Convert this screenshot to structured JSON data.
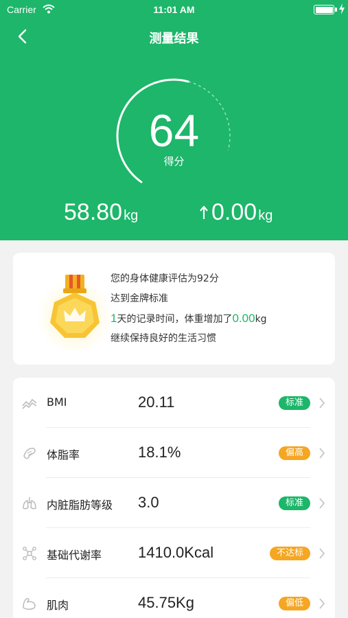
{
  "status_bar": {
    "carrier": "Carrier",
    "time": "11:01 AM"
  },
  "nav": {
    "title": "测量结果"
  },
  "score": {
    "value": "64",
    "label": "得分",
    "arc_fraction": 0.64
  },
  "stats": {
    "weight": {
      "value": "58.80",
      "unit": "kg"
    },
    "change": {
      "value": "0.00",
      "unit": "kg",
      "direction": "up"
    }
  },
  "summary": {
    "line1": "您的身体健康评估为92分",
    "line2": "达到金牌标准",
    "days": "1",
    "line3_mid": "天的记录时间，体重增加了",
    "gain": "0.00",
    "gain_unit": "kg",
    "line4": "继续保持良好的生活习惯",
    "medal_icon": "gold-crown-medal"
  },
  "metrics": [
    {
      "name": "BMI",
      "value": "20.11",
      "badge": "标准",
      "status": "ok",
      "icon": "trend-line-icon"
    },
    {
      "name": "体脂率",
      "value": "18.1%",
      "badge": "偏高",
      "status": "warn",
      "icon": "body-fat-icon"
    },
    {
      "name": "内脏脂肪等级",
      "value": "3.0",
      "badge": "标准",
      "status": "ok",
      "icon": "lungs-icon"
    },
    {
      "name": "基础代谢率",
      "value": "1410.0Kcal",
      "badge": "不达标",
      "status": "warn",
      "icon": "molecule-icon"
    },
    {
      "name": "肌肉",
      "value": "45.75Kg",
      "badge": "偏低",
      "status": "warn",
      "icon": "muscle-icon"
    }
  ],
  "colors": {
    "primary": "#1db66a",
    "warning": "#f5a623",
    "background": "#f2f2f2"
  }
}
